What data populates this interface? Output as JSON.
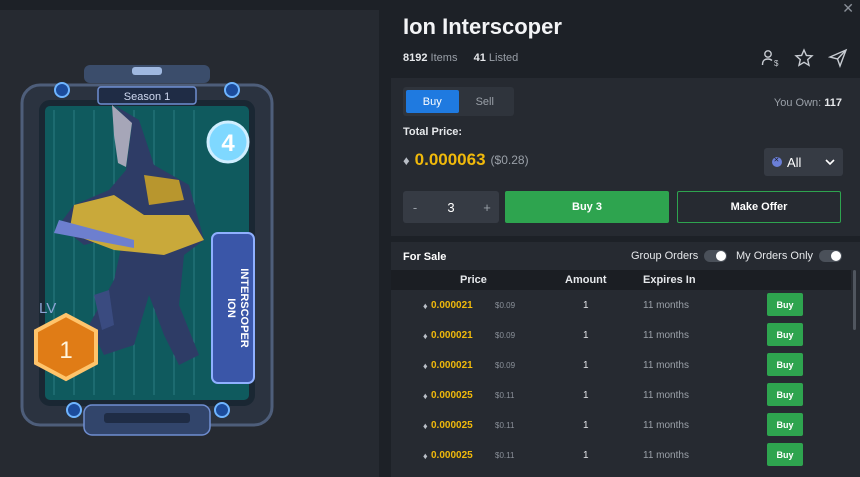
{
  "item": {
    "title": "Ion Interscoper",
    "items_count": "8192",
    "items_label": "Items",
    "listed_count": "41",
    "listed_label": "Listed"
  },
  "card": {
    "season": "Season 1",
    "level_label": "LV",
    "level": "1",
    "badge_number": "4",
    "name_line1": "ION",
    "name_line2": "INTERSCOPER"
  },
  "trade": {
    "buy_tab": "Buy",
    "sell_tab": "Sell",
    "you_own_label": "You Own:",
    "you_own_value": "117",
    "total_label": "Total Price:",
    "total_price": "0.000063",
    "total_usd": "($0.28)",
    "currency": "All",
    "minus": "-",
    "quantity": "3",
    "plus": "+",
    "buy_button": "Buy 3",
    "offer_button": "Make Offer"
  },
  "sale": {
    "title": "For Sale",
    "group_orders": "Group Orders",
    "my_orders_only": "My Orders Only",
    "columns": [
      "Price",
      "Amount",
      "Expires In"
    ],
    "rows": [
      {
        "price": "0.000021",
        "usd": "$0.09",
        "amount": "1",
        "expires": "11 months",
        "action": "Buy"
      },
      {
        "price": "0.000021",
        "usd": "$0.09",
        "amount": "1",
        "expires": "11 months",
        "action": "Buy"
      },
      {
        "price": "0.000021",
        "usd": "$0.09",
        "amount": "1",
        "expires": "11 months",
        "action": "Buy"
      },
      {
        "price": "0.000025",
        "usd": "$0.11",
        "amount": "1",
        "expires": "11 months",
        "action": "Buy"
      },
      {
        "price": "0.000025",
        "usd": "$0.11",
        "amount": "1",
        "expires": "11 months",
        "action": "Buy"
      },
      {
        "price": "0.000025",
        "usd": "$0.11",
        "amount": "1",
        "expires": "11 months",
        "action": "Buy"
      }
    ]
  },
  "colors": {
    "accent_blue": "#1f7ae0",
    "buy_green": "#2ea44f",
    "price_gold": "#f0b90b"
  },
  "icons": {
    "close": "close-icon",
    "owners": "owners-icon",
    "favorite": "star-icon",
    "share": "send-icon",
    "eth": "eth-icon",
    "chevron": "chevron-down-icon"
  }
}
